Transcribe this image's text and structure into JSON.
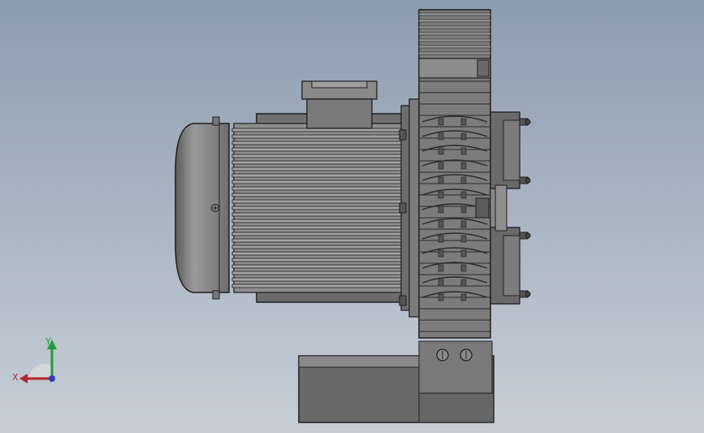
{
  "viewport": {
    "background_top": "#8c9cb0",
    "background_bottom": "#c7ced7"
  },
  "model": {
    "body_color": "#7d7d7d",
    "fin_color": "#8e8e8e",
    "dark_color": "#3a3a3a",
    "outline_color": "#1e1e1e"
  },
  "triad": {
    "x_label": "X",
    "y_label": "Y",
    "x_color": "#b3272a",
    "y_color": "#1f9d3a",
    "z_color": "#2a3fb8"
  }
}
